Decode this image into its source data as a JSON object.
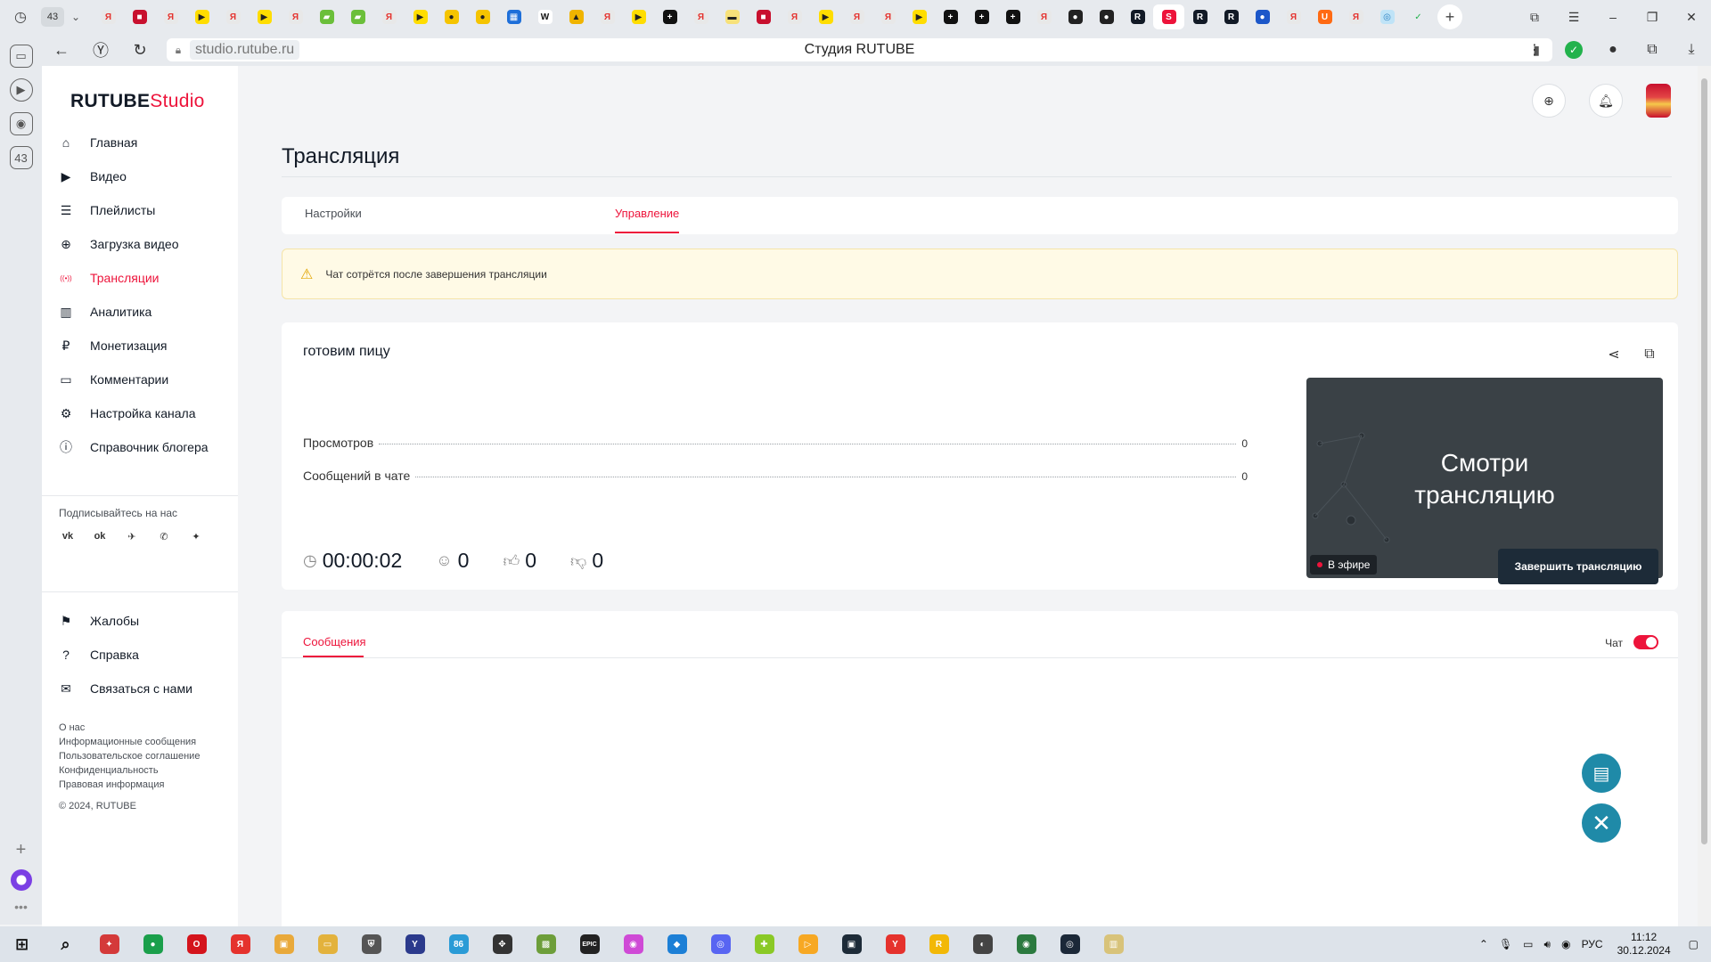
{
  "browser": {
    "tab_counter": "43",
    "tabs": [
      {
        "bg": "#e8e8e8",
        "fg": "#e5322d",
        "glyph": "Я"
      },
      {
        "bg": "#c8102e",
        "fg": "#fff",
        "glyph": "■"
      },
      {
        "bg": "#e8e8e8",
        "fg": "#e5322d",
        "glyph": "Я"
      },
      {
        "bg": "#ffdd00",
        "fg": "#222",
        "glyph": "▶"
      },
      {
        "bg": "#e8e8e8",
        "fg": "#e5322d",
        "glyph": "Я"
      },
      {
        "bg": "#ffdd00",
        "fg": "#222",
        "glyph": "▶"
      },
      {
        "bg": "#e8e8e8",
        "fg": "#e5322d",
        "glyph": "Я"
      },
      {
        "bg": "#6bbf3a",
        "fg": "#fff",
        "glyph": "▰"
      },
      {
        "bg": "#6bbf3a",
        "fg": "#fff",
        "glyph": "▰"
      },
      {
        "bg": "#e8e8e8",
        "fg": "#e5322d",
        "glyph": "Я"
      },
      {
        "bg": "#ffdd00",
        "fg": "#222",
        "glyph": "▶"
      },
      {
        "bg": "#f5c400",
        "fg": "#222",
        "glyph": "●"
      },
      {
        "bg": "#f5c400",
        "fg": "#222",
        "glyph": "●"
      },
      {
        "bg": "#1e6fd9",
        "fg": "#fff",
        "glyph": "▦"
      },
      {
        "bg": "#ffffff",
        "fg": "#111",
        "glyph": "W"
      },
      {
        "bg": "#f0b400",
        "fg": "#222",
        "glyph": "▲"
      },
      {
        "bg": "#e8e8e8",
        "fg": "#e5322d",
        "glyph": "Я"
      },
      {
        "bg": "#ffdd00",
        "fg": "#222",
        "glyph": "▶"
      },
      {
        "bg": "#111111",
        "fg": "#fff",
        "glyph": "+"
      },
      {
        "bg": "#e8e8e8",
        "fg": "#e5322d",
        "glyph": "Я"
      },
      {
        "bg": "#f7e17a",
        "fg": "#222",
        "glyph": "▬"
      },
      {
        "bg": "#c8102e",
        "fg": "#fff",
        "glyph": "■"
      },
      {
        "bg": "#e8e8e8",
        "fg": "#e5322d",
        "glyph": "Я"
      },
      {
        "bg": "#ffdd00",
        "fg": "#222",
        "glyph": "▶"
      },
      {
        "bg": "#e8e8e8",
        "fg": "#e5322d",
        "glyph": "Я"
      },
      {
        "bg": "#e8e8e8",
        "fg": "#e5322d",
        "glyph": "Я"
      },
      {
        "bg": "#ffdd00",
        "fg": "#222",
        "glyph": "▶"
      },
      {
        "bg": "#111111",
        "fg": "#fff",
        "glyph": "+"
      },
      {
        "bg": "#111111",
        "fg": "#fff",
        "glyph": "+"
      },
      {
        "bg": "#111111",
        "fg": "#fff",
        "glyph": "+"
      },
      {
        "bg": "#e8e8e8",
        "fg": "#e5322d",
        "glyph": "Я"
      },
      {
        "bg": "#222222",
        "fg": "#fff",
        "glyph": "●"
      },
      {
        "bg": "#222222",
        "fg": "#fff",
        "glyph": "●"
      },
      {
        "bg": "#121a26",
        "fg": "#fff",
        "glyph": "R"
      },
      {
        "bg": "#ed143b",
        "fg": "#fff",
        "glyph": "S"
      },
      {
        "bg": "#121a26",
        "fg": "#fff",
        "glyph": "R"
      },
      {
        "bg": "#121a26",
        "fg": "#fff",
        "glyph": "R"
      },
      {
        "bg": "#1c57c9",
        "fg": "#fff",
        "glyph": "●"
      },
      {
        "bg": "#e8e8e8",
        "fg": "#e5322d",
        "glyph": "Я"
      },
      {
        "bg": "#ff6a13",
        "fg": "#fff",
        "glyph": "U"
      },
      {
        "bg": "#e8e8e8",
        "fg": "#e5322d",
        "glyph": "Я"
      },
      {
        "bg": "#bfe3f7",
        "fg": "#2a7fc1",
        "glyph": "◎"
      },
      {
        "bg": "#e7eaee",
        "fg": "#22b24c",
        "glyph": "✓"
      }
    ],
    "url": "studio.rutube.ru",
    "title": "Студия RUTUBE"
  },
  "logo": {
    "main": "RUTUBE",
    "suffix": "Studio"
  },
  "sidebar": {
    "nav": [
      {
        "label": "Главная",
        "icon": "home-icon",
        "glyph": "⌂",
        "active": false
      },
      {
        "label": "Видео",
        "icon": "video-icon",
        "glyph": "▶",
        "active": false
      },
      {
        "label": "Плейлисты",
        "icon": "playlist-icon",
        "glyph": "☰",
        "active": false
      },
      {
        "label": "Загрузка видео",
        "icon": "upload-icon",
        "glyph": "⊕",
        "active": false
      },
      {
        "label": "Трансляции",
        "icon": "broadcast-icon",
        "glyph": "((•))",
        "active": true
      },
      {
        "label": "Аналитика",
        "icon": "analytics-icon",
        "glyph": "▥",
        "active": false
      },
      {
        "label": "Монетизация",
        "icon": "ruble-icon",
        "glyph": "₽",
        "active": false
      },
      {
        "label": "Комментарии",
        "icon": "comment-icon",
        "glyph": "▭",
        "active": false
      },
      {
        "label": "Настройка канала",
        "icon": "gear-icon",
        "glyph": "⚙",
        "active": false
      },
      {
        "label": "Справочник блогера",
        "icon": "info-icon",
        "glyph": "ⓘ",
        "active": false
      }
    ],
    "subscribe_title": "Подписывайтесь на нас",
    "social": [
      {
        "icon": "vk-icon",
        "glyph": "vk"
      },
      {
        "icon": "ok-icon",
        "glyph": "ok"
      },
      {
        "icon": "telegram-icon",
        "glyph": "✈"
      },
      {
        "icon": "viber-icon",
        "glyph": "✆"
      },
      {
        "icon": "more-icon",
        "glyph": "✦"
      }
    ],
    "nav2": [
      {
        "label": "Жалобы",
        "icon": "flag-icon",
        "glyph": "⚑"
      },
      {
        "label": "Справка",
        "icon": "help-icon",
        "glyph": "?"
      },
      {
        "label": "Связаться с нами",
        "icon": "mail-icon",
        "glyph": "✉"
      }
    ],
    "footer_links": [
      "О нас",
      "Информационные сообщения",
      "Пользовательское соглашение",
      "Конфиденциальность",
      "Правовая информация"
    ],
    "copyright": "© 2024, RUTUBE"
  },
  "page": {
    "title": "Трансляция",
    "tabs": [
      {
        "label": "Настройки",
        "active": false
      },
      {
        "label": "Управление",
        "active": true
      }
    ],
    "warning": "Чат сотрётся после завершения трансляции",
    "stream": {
      "name": "готовим пицу",
      "stats": [
        {
          "label": "Просмотров",
          "value": "0"
        },
        {
          "label": "Сообщений в чате",
          "value": "0"
        }
      ],
      "duration": "00:00:02",
      "viewers": "0",
      "likes": "0",
      "dislikes": "0",
      "preview_text_line1": "Смотри",
      "preview_text_line2": "трансляцию",
      "live_badge": "В эфире",
      "end_button": "Завершить трансляцию"
    },
    "chat": {
      "tab": "Сообщения",
      "toggle_label": "Чат",
      "toggle_on": true
    }
  },
  "taskbar": {
    "items": [
      {
        "bg": "#d43a3a",
        "glyph": "✦",
        "name": "app-icon"
      },
      {
        "bg": "#1a9f4b",
        "glyph": "●",
        "name": "chrome-icon"
      },
      {
        "bg": "#d4141c",
        "glyph": "O",
        "name": "opera-icon"
      },
      {
        "bg": "#e5322d",
        "glyph": "Я",
        "name": "yandex-icon"
      },
      {
        "bg": "#e9a93a",
        "glyph": "▣",
        "name": "game-icon"
      },
      {
        "bg": "#e3b23c",
        "glyph": "▭",
        "name": "folder-icon"
      },
      {
        "bg": "#555",
        "glyph": "⛨",
        "name": "tanks-icon"
      },
      {
        "bg": "#2b3a8c",
        "glyph": "Y",
        "name": "yandex-music-icon"
      },
      {
        "bg": "#2a9bd6",
        "glyph": "86",
        "name": "telegram-icon"
      },
      {
        "bg": "#333",
        "glyph": "✥",
        "name": "app2-icon"
      },
      {
        "bg": "#6d9e3a",
        "glyph": "▩",
        "name": "minecraft-icon"
      },
      {
        "bg": "#222",
        "glyph": "EPIC",
        "name": "epic-icon"
      },
      {
        "bg": "#cf4ad6",
        "glyph": "◉",
        "name": "app3-icon"
      },
      {
        "bg": "#1c7fd6",
        "glyph": "◆",
        "name": "app4-icon"
      },
      {
        "bg": "#5865f2",
        "glyph": "◎",
        "name": "discord-icon"
      },
      {
        "bg": "#8ac926",
        "glyph": "✚",
        "name": "app5-icon"
      },
      {
        "bg": "#f7a823",
        "glyph": "▷",
        "name": "app6-icon"
      },
      {
        "bg": "#1d2b38",
        "glyph": "▣",
        "name": "app7-icon"
      },
      {
        "bg": "#e5322d",
        "glyph": "Y",
        "name": "yandex-browser-icon"
      },
      {
        "bg": "#f2b807",
        "glyph": "R",
        "name": "rockstar-icon"
      },
      {
        "bg": "#444",
        "glyph": "◐",
        "name": "app8-icon"
      },
      {
        "bg": "#2b7a3f",
        "glyph": "◉",
        "name": "app9-icon"
      },
      {
        "bg": "#1b2838",
        "glyph": "◎",
        "name": "steam-icon"
      },
      {
        "bg": "#d8c37a",
        "glyph": "▥",
        "name": "app10-icon"
      }
    ],
    "lang": "РУС",
    "time": "11:12",
    "date": "30.12.2024"
  }
}
